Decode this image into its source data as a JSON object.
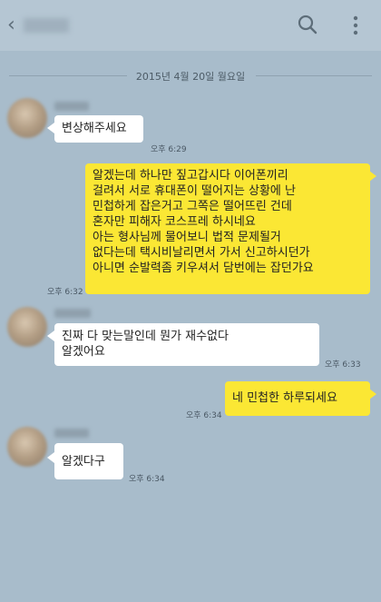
{
  "header": {
    "back_icon": "chevron-left-icon",
    "search_icon": "search-icon",
    "more_icon": "more-vertical-icon"
  },
  "date_divider": "2015년 4월 20일 월요일",
  "colors": {
    "background": "#a8bccb",
    "sent_bubble": "#fbe734",
    "received_bubble": "#ffffff"
  },
  "messages": [
    {
      "side": "received",
      "text": "변상해주세요",
      "time": "오후 6:29"
    },
    {
      "side": "sent",
      "text": "알겠는데 하나만 짚고갑시다 이어폰끼리\n걸려서 서로 휴대폰이 떨어지는 상황에 난\n민첩하게 잡은거고 그쪽은 떨어뜨린 건데\n혼자만 피해자 코스프레 하시네요\n아는 형사님께 물어보니 법적 문제될거\n없다는데 택시비날리면서 가서 신고하시던가\n아니면 순발력좀 키우셔서 담번에는 잡던가요",
      "time": "오후 6:32"
    },
    {
      "side": "received",
      "text": "진짜 다 맞는말인데 뭔가 재수없다\n알겠어요",
      "time": "오후 6:33"
    },
    {
      "side": "sent",
      "text": "네 민첩한 하루되세요",
      "time": "오후 6:34"
    },
    {
      "side": "received",
      "text": "알겠다구",
      "time": "오후 6:34"
    }
  ]
}
